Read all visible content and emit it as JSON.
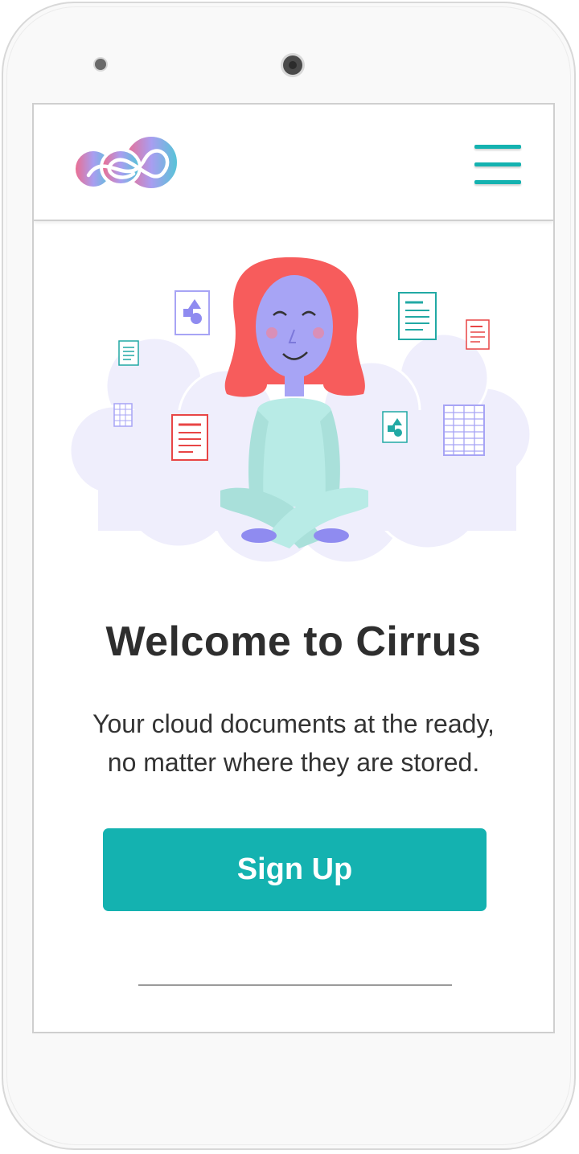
{
  "app": {
    "name": "Cirrus"
  },
  "header": {
    "logo_icon": "cirrus-infinity-logo",
    "menu_icon": "hamburger-menu-icon"
  },
  "welcome": {
    "title": "Welcome to Cirrus",
    "subtitle_line1": "Your cloud documents at the ready,",
    "subtitle_line2": "no matter where they are stored.",
    "illustration": "meditating-woman-on-cloud-with-documents"
  },
  "actions": {
    "signup_label": "Sign Up"
  },
  "colors": {
    "accent": "#14b2b0",
    "hair": "#f75c5c",
    "skin": "#a7a4f5",
    "shirt": "#b8ebe6",
    "cloud": "#efeefc",
    "doc_red": "#e84545",
    "doc_teal": "#21a9a4"
  }
}
